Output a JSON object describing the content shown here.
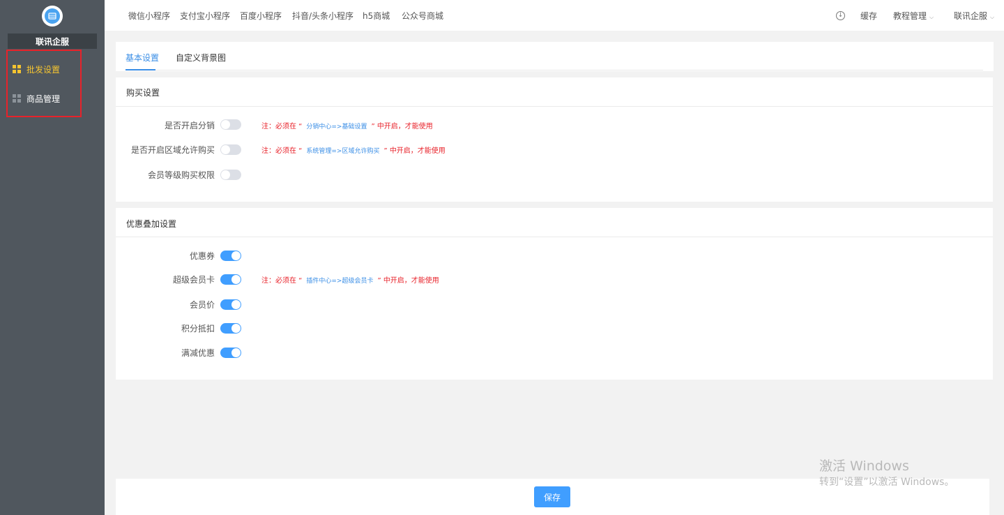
{
  "sidebar": {
    "shop_name": "联讯企服",
    "items": [
      {
        "label": "批发设置",
        "active": true
      },
      {
        "label": "商品管理",
        "active": false
      }
    ]
  },
  "topbar": {
    "nav": [
      "微信小程序",
      "支付宝小程序",
      "百度小程序",
      "抖音/头条小程序",
      "h5商城",
      "公众号商城"
    ],
    "cache": "缓存",
    "tutorial": "教程管理",
    "account": "联讯企服"
  },
  "tabs": [
    "基本设置",
    "自定义背景图"
  ],
  "purchase": {
    "title": "购买设置",
    "rows": [
      {
        "label": "是否开启分销",
        "on": false,
        "note_prefix": "注：必须在 “",
        "note_link": "分销中心=>基础设置",
        "note_suffix": "” 中开启，才能使用"
      },
      {
        "label": "是否开启区域允许购买",
        "on": false,
        "note_prefix": "注：必须在 “",
        "note_link": "系统管理=>区域允许购买",
        "note_suffix": "” 中开启，才能使用"
      },
      {
        "label": "会员等级购买权限",
        "on": false
      }
    ]
  },
  "discount": {
    "title": "优惠叠加设置",
    "rows": [
      {
        "label": "优惠券",
        "on": true
      },
      {
        "label": "超级会员卡",
        "on": true,
        "note_prefix": "注：必须在 “",
        "note_link": "插件中心=>超级会员卡",
        "note_suffix": "” 中开启，才能使用"
      },
      {
        "label": "会员价",
        "on": true
      },
      {
        "label": "积分抵扣",
        "on": true
      },
      {
        "label": "满减优惠",
        "on": true
      }
    ]
  },
  "footer": {
    "save_label": "保存"
  },
  "watermark": {
    "line1": "激活 Windows",
    "line2": "转到“设置”以激活 Windows。"
  },
  "colors": {
    "accent": "#409eff",
    "warning": "#e8222a",
    "sidebar_bg": "#50575e",
    "active_nav": "#f5c430"
  }
}
